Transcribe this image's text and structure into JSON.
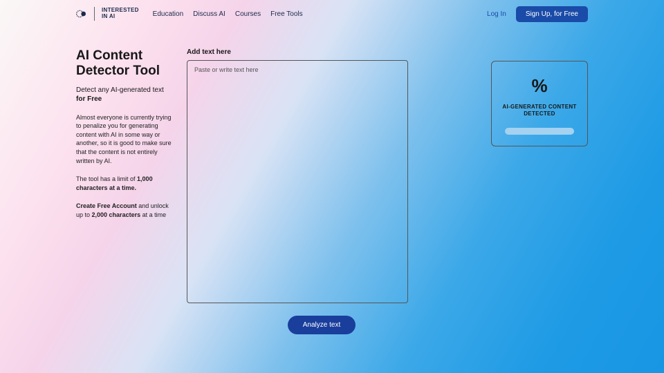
{
  "header": {
    "logo_line1": "INTERESTED",
    "logo_line2": "IN AI",
    "nav": [
      "Education",
      "Discuss AI",
      "Courses",
      "Free Tools"
    ],
    "login": "Log In",
    "signup": "Sign Up, for Free"
  },
  "left": {
    "title": "AI Content Detector Tool",
    "subtitle_plain": "Detect any AI-generated text ",
    "subtitle_bold": "for Free",
    "para1": "Almost everyone is currently trying to penalize you for generating content with AI in some way or another, so it is good to make sure that the content is not entirely written by AI.",
    "para2_a": "The tool has a limit of ",
    "para2_b": "1,000 characters at a time.",
    "para3_a": "Create Free Account",
    "para3_b": " and unlock up to ",
    "para3_c": "2,000 characters",
    "para3_d": " at a time"
  },
  "center": {
    "input_label": "Add text here",
    "placeholder": "Paste or write text here",
    "analyze_label": "Analyze text"
  },
  "result": {
    "percent": "%",
    "label": "AI-GENERATED CONTENT DETECTED"
  }
}
